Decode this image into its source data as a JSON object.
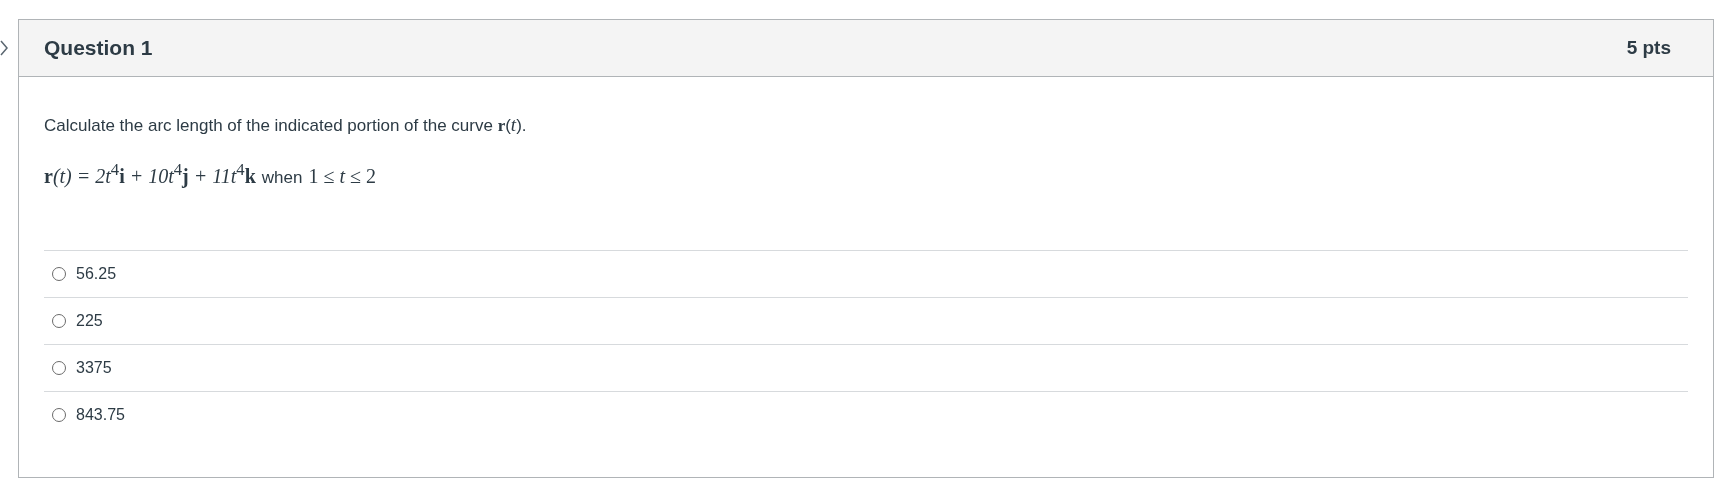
{
  "question": {
    "title": "Question 1",
    "points": "5 pts"
  },
  "prompt": "Calculate the arc length of the indicated portion of the curve **r**(*t*).",
  "formula": {
    "expression": "**r**(t) = 2t$^{4}$**i** + 10t$^{4}$**j** + 11t$^{4}$**k**",
    "connector": "when",
    "condition": "1 ≤ *t* ≤ 2"
  },
  "options": [
    {
      "label": "56.25",
      "selected": false
    },
    {
      "label": "225",
      "selected": false
    },
    {
      "label": "3375",
      "selected": false
    },
    {
      "label": "843.75",
      "selected": false
    }
  ]
}
